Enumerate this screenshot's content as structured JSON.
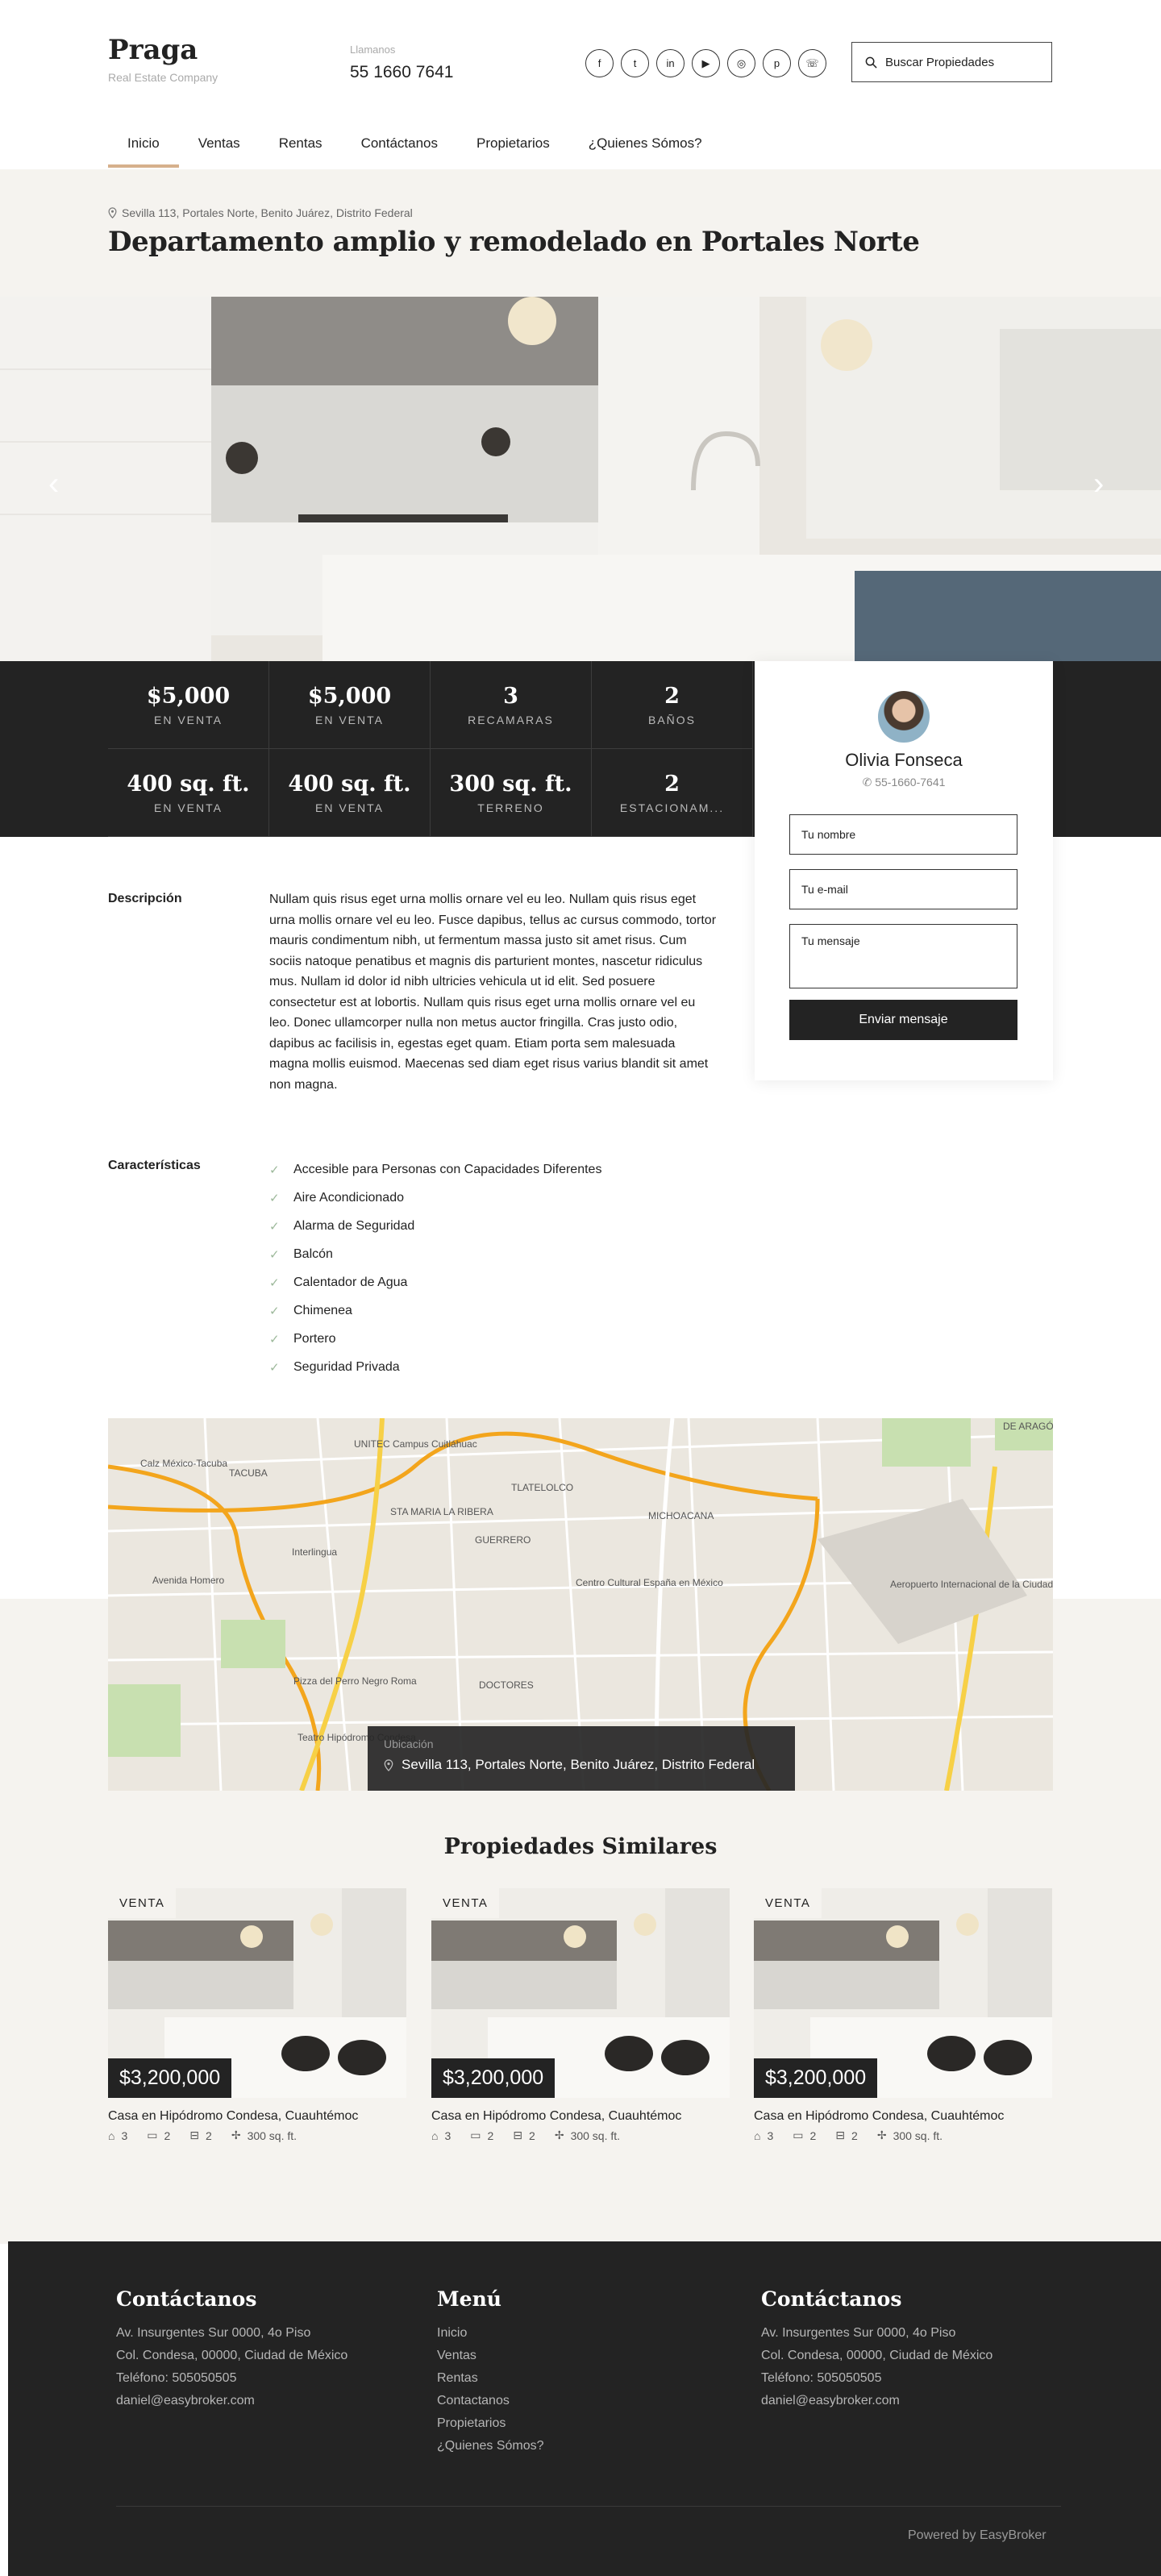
{
  "brand": {
    "name": "Praga",
    "tagline": "Real Estate Company"
  },
  "contact": {
    "label": "Llamanos",
    "phone": "55 1660 7641"
  },
  "socials": [
    {
      "icon": "facebook-icon",
      "glyph": "f"
    },
    {
      "icon": "twitter-icon",
      "glyph": "t"
    },
    {
      "icon": "linkedin-icon",
      "glyph": "in"
    },
    {
      "icon": "youtube-icon",
      "glyph": "▶"
    },
    {
      "icon": "instagram-icon",
      "glyph": "◎"
    },
    {
      "icon": "pinterest-icon",
      "glyph": "p"
    },
    {
      "icon": "whatsapp-icon",
      "glyph": "☏"
    }
  ],
  "search": {
    "label": "Buscar Propiedades"
  },
  "nav": [
    {
      "label": "Inicio",
      "active": true
    },
    {
      "label": "Ventas"
    },
    {
      "label": "Rentas"
    },
    {
      "label": "Contáctanos"
    },
    {
      "label": "Propietarios"
    },
    {
      "label": "¿Quienes Sómos?"
    }
  ],
  "property": {
    "address": "Sevilla 113, Portales Norte, Benito Juárez, Distrito Federal",
    "title": "Departamento amplio y remodelado en Portales Norte"
  },
  "stats": [
    {
      "value": "$5,000",
      "label": "EN VENTA"
    },
    {
      "value": "$5,000",
      "label": "EN VENTA"
    },
    {
      "value": "3",
      "label": "RECAMARAS"
    },
    {
      "value": "2",
      "label": "BAÑOS"
    },
    {
      "value": "400 sq. ft.",
      "label": "EN VENTA"
    },
    {
      "value": "400 sq. ft.",
      "label": "EN VENTA"
    },
    {
      "value": "300 sq. ft.",
      "label": "TERRENO"
    },
    {
      "value": "2",
      "label": "ESTACIONAM..."
    }
  ],
  "agent": {
    "name": "Olivia Fonseca",
    "phone": "55-1660-7641",
    "name_placeholder": "Tu nombre",
    "email_placeholder": "Tu e-mail",
    "message_placeholder": "Tu mensaje",
    "send_label": "Enviar mensaje"
  },
  "description": {
    "label": "Descripción",
    "text": "Nullam quis risus eget urna mollis ornare vel eu leo. Nullam quis risus eget urna mollis ornare vel eu leo. Fusce dapibus, tellus ac cursus commodo, tortor mauris condimentum nibh, ut fermentum massa justo sit amet risus. Cum sociis natoque penatibus et magnis dis parturient montes, nascetur ridiculus mus. Nullam id dolor id nibh ultricies vehicula ut id elit. Sed posuere consectetur est at lobortis. Nullam quis risus eget urna mollis ornare vel eu leo. Donec ullamcorper nulla non metus auctor fringilla. Cras justo odio, dapibus ac facilisis in, egestas eget quam. Etiam porta sem malesuada magna mollis euismod. Maecenas sed diam eget risus varius blandit sit amet non magna."
  },
  "features": {
    "label": "Características",
    "items": [
      "Accesible para Personas con Capacidades Diferentes",
      "Aire Acondicionado",
      "Alarma de Seguridad",
      "Balcón",
      "Calentador de Agua",
      "Chimenea",
      "Portero",
      "Seguridad Privada"
    ]
  },
  "map": {
    "location_label": "Ubicación",
    "location_value": "Sevilla 113, Portales Norte, Benito Juárez, Distrito Federal",
    "places": [
      "TACUBA",
      "STA MARIA LA RIBERA",
      "GUERRERO",
      "DOCTORES",
      "TLATELOLCO",
      "MICHOACANA",
      "Interlingua",
      "Centro Cultural España en México",
      "Aeropuerto Internacional de la Ciudad de México",
      "UNITEC Campus Cuitláhuac",
      "Pizza del Perro Negro Roma",
      "Teatro Hipódromo Condesa",
      "DE ARAGÓN",
      "Calz México-Tacuba",
      "Avenida Homero"
    ]
  },
  "similar": {
    "title": "Propiedades Similares",
    "cards": [
      {
        "badge": "VENTA",
        "price": "$3,200,000",
        "name": "Casa en Hipódromo Condesa, Cuauhtémoc",
        "beds": "3",
        "baths": "2",
        "parking": "2",
        "area": "300 sq. ft."
      },
      {
        "badge": "VENTA",
        "price": "$3,200,000",
        "name": "Casa en Hipódromo Condesa, Cuauhtémoc",
        "beds": "3",
        "baths": "2",
        "parking": "2",
        "area": "300 sq. ft."
      },
      {
        "badge": "VENTA",
        "price": "$3,200,000",
        "name": "Casa en Hipódromo Condesa, Cuauhtémoc",
        "beds": "3",
        "baths": "2",
        "parking": "2",
        "area": "300 sq. ft."
      }
    ]
  },
  "footer": {
    "contact1": {
      "title": "Contáctanos",
      "address1": "Av. Insurgentes Sur 0000, 4o Piso",
      "address2": "Col. Condesa, 00000, Ciudad de México",
      "phone": "Teléfono: 505050505",
      "email": "daniel@easybroker.com"
    },
    "menu": {
      "title": "Menú",
      "items": [
        "Inicio",
        "Ventas",
        "Rentas",
        "Contactanos",
        "Propietarios",
        "¿Quienes Sómos?"
      ]
    },
    "contact2": {
      "title": "Contáctanos",
      "address1": "Av. Insurgentes Sur 0000, 4o Piso",
      "address2": "Col. Condesa, 00000, Ciudad de México",
      "phone": "Teléfono: 505050505",
      "email": "daniel@easybroker.com"
    },
    "powered": "Powered by EasyBroker"
  },
  "colors": {
    "accent": "#d6b08c",
    "dark": "#232323",
    "band": "#f5f3ef"
  }
}
